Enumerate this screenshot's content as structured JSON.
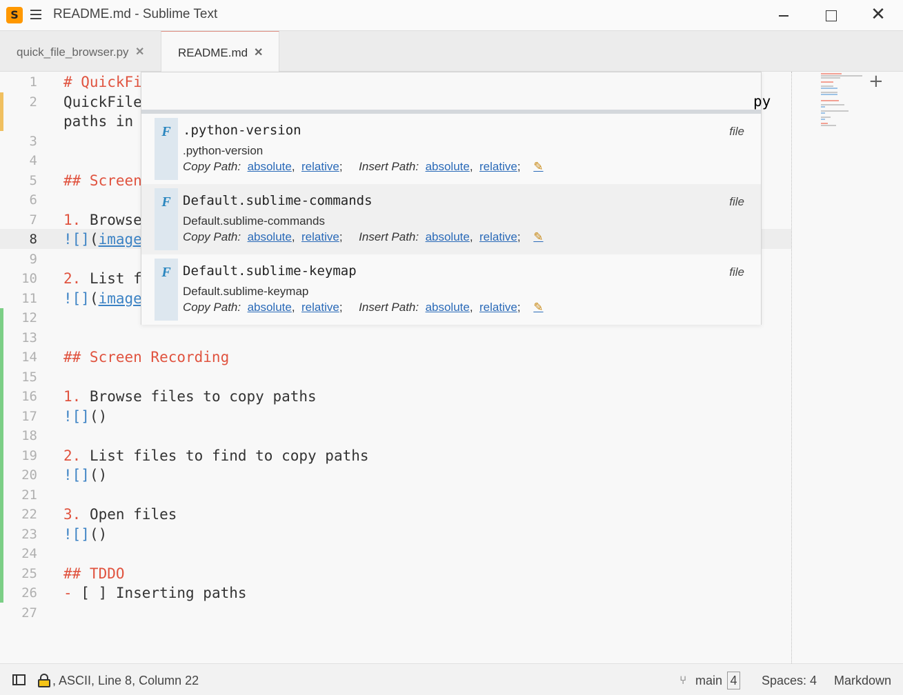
{
  "window": {
    "title": "README.md - Sublime Text",
    "icon": "sublime-icon",
    "close_glyph": "✕"
  },
  "tabs": [
    {
      "label": "quick_file_browser.py",
      "close": "✕",
      "active": false
    },
    {
      "label": "README.md",
      "close": "✕",
      "active": true
    }
  ],
  "tab_add": "+",
  "editor": {
    "active_line": 8,
    "lines": [
      {
        "n": "1",
        "text": "# QuickFi"
      },
      {
        "n": "2",
        "text": "QuickFile"
      },
      {
        "n": "",
        "text": "paths in "
      },
      {
        "n": "3",
        "text": ""
      },
      {
        "n": "4",
        "text": ""
      },
      {
        "n": "5",
        "text": "## Screen"
      },
      {
        "n": "6",
        "text": ""
      },
      {
        "n": "7",
        "text": "1. Browse"
      },
      {
        "n": "8",
        "text": "![](image"
      },
      {
        "n": "9",
        "text": ""
      },
      {
        "n": "10",
        "text": "2. List f"
      },
      {
        "n": "11",
        "text": "![](image"
      },
      {
        "n": "12",
        "text": ""
      },
      {
        "n": "13",
        "text": ""
      },
      {
        "n": "14",
        "text": "## Screen Recording"
      },
      {
        "n": "15",
        "text": ""
      },
      {
        "n": "16",
        "text": "1. Browse files to copy paths"
      },
      {
        "n": "17",
        "text": "![]()"
      },
      {
        "n": "18",
        "text": ""
      },
      {
        "n": "19",
        "text": "2. List files to find to copy paths"
      },
      {
        "n": "20",
        "text": "![]()"
      },
      {
        "n": "21",
        "text": ""
      },
      {
        "n": "22",
        "text": "3. Open files"
      },
      {
        "n": "23",
        "text": "![]()"
      },
      {
        "n": "24",
        "text": ""
      },
      {
        "n": "25",
        "text": "## TDDO"
      },
      {
        "n": "26",
        "text": "- [ ] Inserting paths"
      },
      {
        "n": "27",
        "text": ""
      }
    ],
    "line2_overflow": "py"
  },
  "popup": {
    "input_value": "",
    "items": [
      {
        "kind_letter": "F",
        "title": ".python-version",
        "subtitle": ".python-version",
        "kind": "file",
        "copy_label": "Copy Path:",
        "insert_label": "Insert Path:",
        "absolute": "absolute",
        "relative": "relative",
        "edit_icon": "✎"
      },
      {
        "kind_letter": "F",
        "title": "Default.sublime-commands",
        "subtitle": "Default.sublime-commands",
        "kind": "file",
        "copy_label": "Copy Path:",
        "insert_label": "Insert Path:",
        "absolute": "absolute",
        "relative": "relative",
        "edit_icon": "✎"
      },
      {
        "kind_letter": "F",
        "title": "Default.sublime-keymap",
        "subtitle": "Default.sublime-keymap",
        "kind": "file",
        "copy_label": "Copy Path:",
        "insert_label": "Insert Path:",
        "absolute": "absolute",
        "relative": "relative",
        "edit_icon": "✎"
      }
    ]
  },
  "statusbar": {
    "position": ", ASCII, Line 8, Column 22",
    "branch": "main",
    "branch_count": "4",
    "spaces": "Spaces: 4",
    "syntax": "Markdown"
  },
  "colors": {
    "heading": "#e0533f",
    "link": "#3b82c4",
    "modified_gutter": "#f0c060",
    "added_gutter": "#7ccf86",
    "accent_tab": "#e08f84"
  }
}
